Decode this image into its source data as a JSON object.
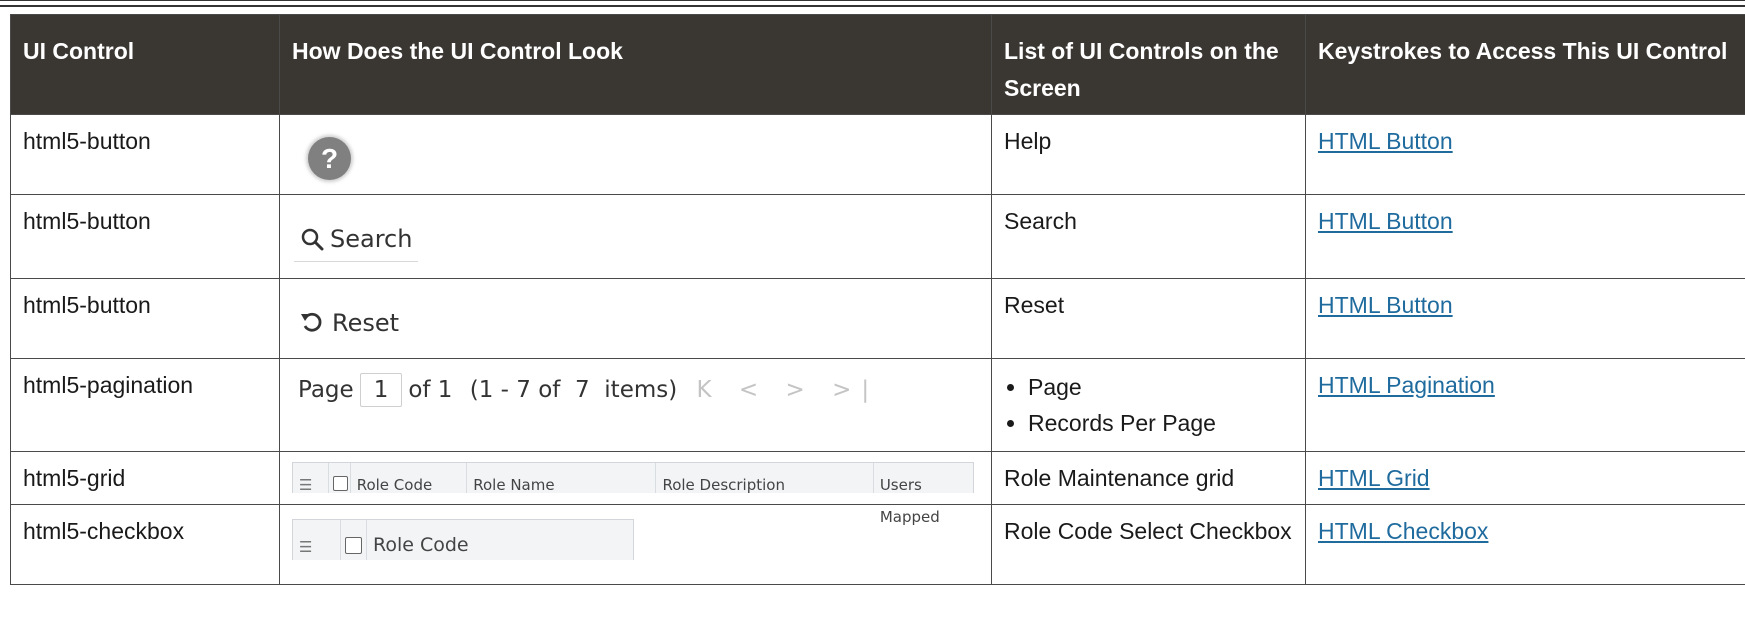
{
  "columns": [
    "UI Control",
    "How Does the UI Control Look",
    "List of UI Controls on the Screen",
    "Keystrokes to Access This UI Control"
  ],
  "rows": [
    {
      "control": "html5-button",
      "screen": "Help",
      "link": "HTML Button"
    },
    {
      "control": "html5-button",
      "screen": "Search",
      "link": "HTML Button"
    },
    {
      "control": "html5-button",
      "screen": "Reset",
      "link": "HTML Button"
    },
    {
      "control": "html5-pagination",
      "screen_items": [
        "Page",
        "Records Per Page"
      ],
      "link": "HTML Pagination"
    },
    {
      "control": "html5-grid",
      "screen": "Role Maintenance grid",
      "link": "HTML Grid"
    },
    {
      "control": "html5-checkbox",
      "screen": "Role Code Select Checkbox",
      "link": "HTML Checkbox"
    }
  ],
  "demos": {
    "help": {
      "glyph": "?",
      "icon": "help-icon"
    },
    "search": {
      "label": "Search",
      "icon": "search-icon"
    },
    "reset": {
      "label": "Reset",
      "icon": "reset-icon"
    },
    "pagination": {
      "page_label": "Page",
      "page_value": "1",
      "of_label": "of 1",
      "range_text": "(1 - 7 of  7  items)",
      "nav_glyphs": "K < > >|"
    },
    "grid": {
      "headers": [
        "Role Code",
        "Role Name",
        "Role Description",
        "Users Mapped"
      ]
    },
    "checkbox": {
      "header": "Role Code"
    }
  },
  "colors": {
    "header_bg": "#3a3632",
    "link": "#1f6b9e",
    "border": "#4a4a4a"
  }
}
